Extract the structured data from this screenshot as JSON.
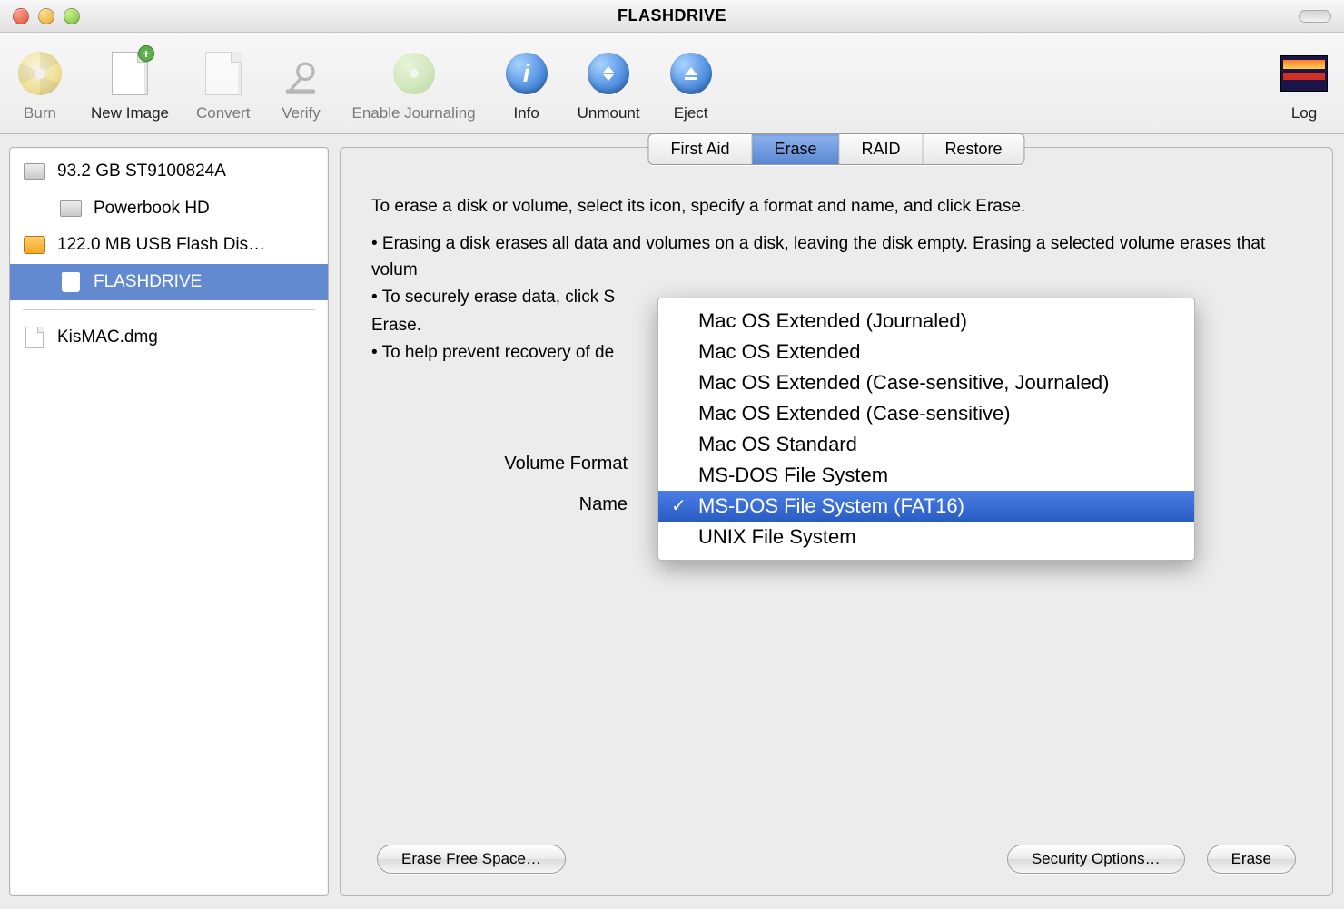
{
  "window": {
    "title": "FLASHDRIVE"
  },
  "toolbar": {
    "burn": "Burn",
    "new_image": "New Image",
    "convert": "Convert",
    "verify": "Verify",
    "enable_journaling": "Enable Journaling",
    "info": "Info",
    "unmount": "Unmount",
    "eject": "Eject",
    "log": "Log"
  },
  "sidebar": {
    "items": [
      {
        "label": "93.2 GB ST9100824A",
        "icon": "hd"
      },
      {
        "label": "Powerbook HD",
        "icon": "hd",
        "indent": true
      },
      {
        "label": "122.0 MB USB Flash Dis…",
        "icon": "usb"
      },
      {
        "label": "FLASHDRIVE",
        "icon": "vol",
        "indent": true,
        "selected": true
      }
    ],
    "below": [
      {
        "label": "KisMAC.dmg",
        "icon": "dmg"
      }
    ]
  },
  "tabs": [
    "First Aid",
    "Erase",
    "RAID",
    "Restore"
  ],
  "active_tab": "Erase",
  "erase": {
    "intro": "To erase a disk or volume, select its icon, specify a format and name, and click Erase.",
    "b1": "• Erasing a disk erases all data and volumes on a disk, leaving the disk empty. Erasing a selected volume erases that volum",
    "b2": "• To securely erase data, click S",
    "b2b": "Erase.",
    "b3": "• To help prevent recovery of de",
    "volume_format_label": "Volume Format",
    "name_label": "Name"
  },
  "buttons": {
    "erase_free": "Erase Free Space…",
    "security": "Security Options…",
    "erase": "Erase"
  },
  "format_menu": {
    "options": [
      "Mac OS Extended (Journaled)",
      "Mac OS Extended",
      "Mac OS Extended (Case-sensitive, Journaled)",
      "Mac OS Extended (Case-sensitive)",
      "Mac OS Standard",
      "MS-DOS File System",
      "MS-DOS File System (FAT16)",
      "UNIX File System"
    ],
    "selected_index": 6
  }
}
